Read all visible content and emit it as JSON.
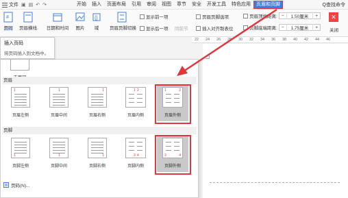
{
  "menubar": {
    "file_label": "文件",
    "tabs": [
      "开始",
      "插入",
      "页面布局",
      "引用",
      "审阅",
      "视图",
      "章节",
      "安全",
      "开发工具",
      "特色应用",
      "页眉和页脚"
    ],
    "search_label": "Q查找命令"
  },
  "ribbon": {
    "page_number": "页码",
    "header_footer_style": "页眉横线",
    "date_time": "日期和时间",
    "picture": "图片",
    "field": "域",
    "switch_header_footer": "页眉页脚切换",
    "show_prev": "显示前一项",
    "show_next": "显示后一项",
    "same_as_prev": "同前节",
    "header_footer_options": "页眉页脚选项",
    "insert_align_tab": "插入对齐制表位",
    "header_top_distance_label": "页眉顶端距离:",
    "header_top_distance_value": "1.50厘米",
    "footer_bottom_distance_label": "页脚底端距离:",
    "footer_bottom_distance_value": "1.75厘米",
    "close": "关闭",
    "minus": "−",
    "plus": "+"
  },
  "ruler": [
    "22",
    "24",
    "26",
    "28",
    "30",
    "32",
    "34",
    "36",
    "38",
    "40",
    "42",
    "44",
    "46"
  ],
  "tooltip": {
    "title": "插入页码",
    "desc": "将页码插入到文档中。"
  },
  "panel": {
    "no_page_number": "无页码",
    "header_section": "页眉",
    "footer_section": "页脚",
    "header_items": [
      "页眉左侧",
      "页眉中间",
      "页眉右侧",
      "页眉内侧",
      "页眉外侧"
    ],
    "footer_items": [
      "页脚左侧",
      "页脚中间",
      "页脚右侧",
      "页脚内侧",
      "页脚外侧"
    ],
    "more": "页码(N)...",
    "sample_number": "1",
    "sample_number_2": "2",
    "sample_number_3": "3",
    "sample_number_4": "4"
  },
  "colors": {
    "accent": "#3d7be6",
    "highlight": "#e0353a"
  }
}
